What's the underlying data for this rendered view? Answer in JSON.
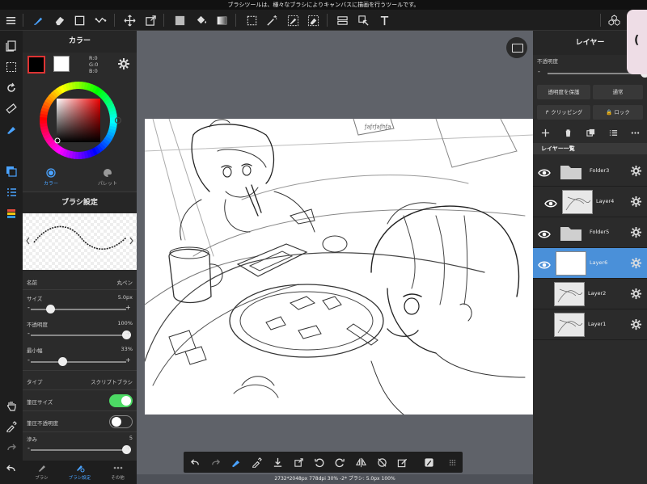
{
  "hint": "ブラシツールは、様々なブラシによりキャンバスに描画を行うツールです。",
  "toolbar": {
    "menu_icon": "menu-icon",
    "tools": [
      "brush-icon",
      "eraser-icon",
      "shape-icon",
      "dot-icon",
      "move-icon",
      "transform-icon",
      "fill-color-icon",
      "bucket-icon",
      "gradient-icon",
      "select-icon",
      "magic-wand-icon",
      "select-pen-icon",
      "select-eraser-icon",
      "layer-move-icon",
      "tap-icon",
      "text-icon"
    ],
    "materials_icon": "cubes-icon"
  },
  "color_panel": {
    "title": "カラー",
    "rgb": [
      "R:0",
      "G:0",
      "B:0"
    ],
    "tabs": [
      {
        "label": "カラー",
        "icon": "circle-icon"
      },
      {
        "label": "パレット",
        "icon": "palette-icon"
      }
    ],
    "colors": {
      "main": "#000000",
      "sub": "#ffffff",
      "accent": "#4aa3ff"
    }
  },
  "brush_settings": {
    "title": "ブラシ設定",
    "name_label": "名前",
    "name_value": "丸ペン",
    "size_label": "サイズ",
    "size_value": "5.0px",
    "size_fraction": 0.2,
    "opacity_label": "不透明度",
    "opacity_value": "100%",
    "opacity_fraction": 1.0,
    "min_width_label": "最小幅",
    "min_width_value": "33%",
    "min_width_fraction": 0.33,
    "type_label": "タイプ",
    "type_value": "スクリプトブラシ",
    "pressure_size_label": "筆圧サイズ",
    "pressure_size_on": true,
    "pressure_opacity_label": "筆圧不透明度",
    "pressure_opacity_on": false,
    "smoothing_label": "滲み",
    "smoothing_value": "5",
    "smoothing_fraction": 1.0,
    "minus": "-",
    "plus": "+"
  },
  "bottom_tabs": [
    {
      "label": "ブラシ",
      "icon": "brush-icon"
    },
    {
      "label": "ブラシ設定",
      "icon": "brush-settings-icon",
      "active": true
    },
    {
      "label": "その他",
      "icon": "more-icon"
    }
  ],
  "status": "2732*2048px 778dpi 30% -2* ブラシ: 5.0px 100%",
  "layers_panel": {
    "title": "レイヤー",
    "opacity_label": "不透明度",
    "minus": "-",
    "protect_alpha": "透明度を保護",
    "blend_mode": "通常",
    "clipping": "クリッピング",
    "lock": "ロック",
    "list_title": "レイヤー一覧",
    "layers": [
      {
        "name": "Folder3",
        "type": "folder",
        "visible": true,
        "selected": false
      },
      {
        "name": "Layer4",
        "type": "layer",
        "visible": true,
        "selected": false,
        "indented": true
      },
      {
        "name": "Folder5",
        "type": "folder",
        "visible": true,
        "selected": false
      },
      {
        "name": "Layer6",
        "type": "layer",
        "visible": true,
        "selected": true
      },
      {
        "name": "Layer2",
        "type": "layer",
        "visible": false,
        "selected": false
      },
      {
        "name": "Layer1",
        "type": "layer",
        "visible": false,
        "selected": false
      }
    ]
  },
  "side_tab_glyph": "(",
  "artwork_sign": "ƒaƒrƒaƒhƒa"
}
